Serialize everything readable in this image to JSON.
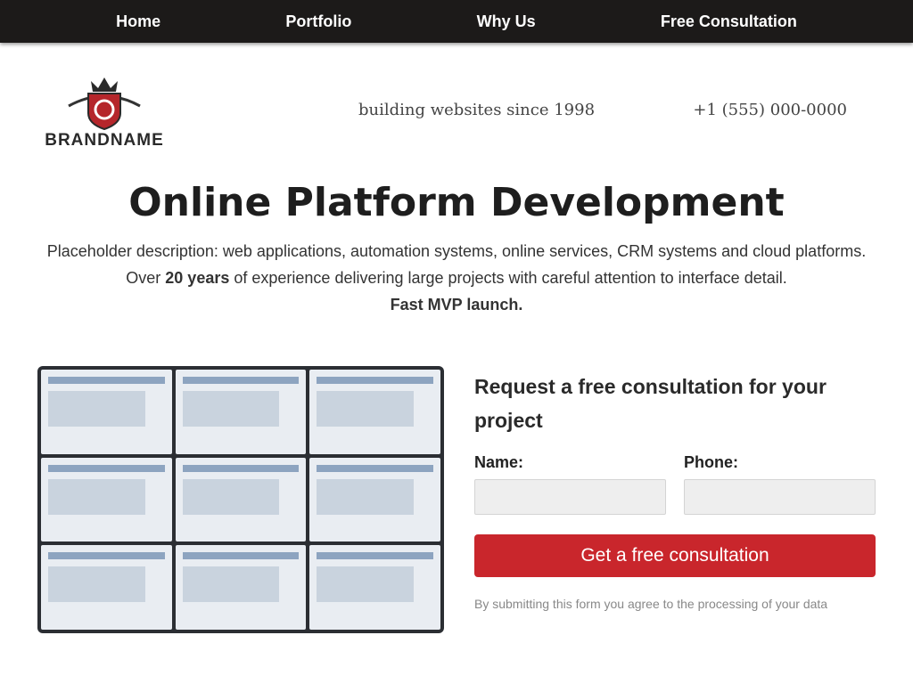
{
  "nav": [
    {
      "label": "Home"
    },
    {
      "label": "Portfolio"
    },
    {
      "label": "Why Us"
    },
    {
      "label": "Free Consultation"
    }
  ],
  "header": {
    "logo_text": "BRANDNAME",
    "tagline": "building websites since 1998",
    "phone": "+1 (555) 000-0000"
  },
  "hero": {
    "title": "Online Platform Development",
    "desc_part1": "Placeholder description: web applications, automation systems, online services, CRM systems and cloud platforms. Over",
    "desc_accent": "20 years",
    "desc_part2": "of experience delivering large projects with careful attention to interface detail.",
    "mvp": "Fast MVP launch."
  },
  "form": {
    "title": "Request a free consultation for your project",
    "name_label": "Name:",
    "phone_label": "Phone:",
    "submit": "Get a free consultation",
    "consent": "By submitting this form you agree to the processing of your data"
  },
  "colors": {
    "nav_bg": "#1c1a19",
    "accent": "#c9262c"
  }
}
